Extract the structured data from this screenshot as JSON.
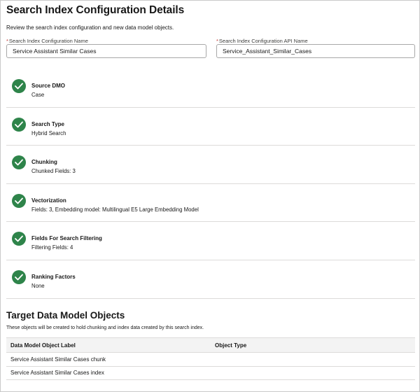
{
  "header": {
    "title": "Search Index Configuration Details",
    "subtitle": "Review the search index configuration and new data model objects."
  },
  "fields": {
    "name_label": "Search Index Configuration Name",
    "name_value": "Service Assistant Similar Cases",
    "api_label": "Search Index Configuration API Name",
    "api_value": "Service_Assistant_Similar_Cases",
    "required_marker": "*"
  },
  "steps": [
    {
      "name": "Source DMO",
      "detail": "Case",
      "icon": "check-icon"
    },
    {
      "name": "Search Type",
      "detail": "Hybrid Search",
      "icon": "check-icon"
    },
    {
      "name": "Chunking",
      "detail": "Chunked Fields: 3",
      "icon": "check-icon"
    },
    {
      "name": "Vectorization",
      "detail": "Fields: 3, Embedding model: Multilingual E5 Large Embedding Model",
      "icon": "check-icon"
    },
    {
      "name": "Fields For Search Filtering",
      "detail": "Filtering Fields: 4",
      "icon": "check-icon"
    },
    {
      "name": "Ranking Factors",
      "detail": "None",
      "icon": "check-icon"
    }
  ],
  "target": {
    "title": "Target Data Model Objects",
    "subtitle": "These objects will be created to hold chunking and index data created by this search index.",
    "columns": [
      "Data Model Object Label",
      "Object Type"
    ],
    "rows": [
      [
        "Service Assistant Similar Cases chunk",
        ""
      ],
      [
        "Service Assistant Similar Cases index",
        ""
      ]
    ]
  },
  "colors": {
    "success": "#2e844a",
    "required": "#c23934",
    "border": "#dddbda"
  }
}
